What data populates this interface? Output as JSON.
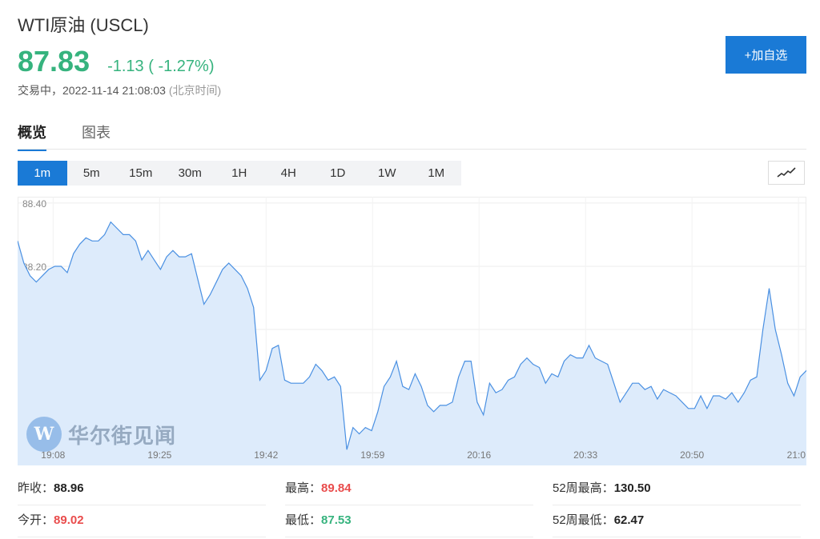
{
  "header": {
    "title": "WTI原油 (USCL)",
    "price": "87.83",
    "change": "-1.13 ( -1.27%)",
    "status": "交易中，2022-11-14 21:08:03",
    "timezone": "(北京时间)",
    "add_button": "+加自选"
  },
  "tabs": [
    {
      "label": "概览",
      "active": true
    },
    {
      "label": "图表",
      "active": false
    }
  ],
  "periods": [
    "1m",
    "5m",
    "15m",
    "30m",
    "1H",
    "4H",
    "1D",
    "1W",
    "1M"
  ],
  "active_period": "1m",
  "watermark": {
    "logo": "W",
    "text": "华尔街见闻"
  },
  "colors": {
    "up": "#e94c4c",
    "down": "#36b37e",
    "accent": "#1a7ad6",
    "line": "#4a90e2",
    "fill": "#ddebfb"
  },
  "stats": {
    "prev_close": {
      "label": "昨收：",
      "value": "88.96"
    },
    "high": {
      "label": "最高：",
      "value": "89.84"
    },
    "high_52w": {
      "label": "52周最高：",
      "value": "130.50"
    },
    "open": {
      "label": "今开：",
      "value": "89.02"
    },
    "low": {
      "label": "最低：",
      "value": "87.53"
    },
    "low_52w": {
      "label": "52周最低：",
      "value": "62.47"
    }
  },
  "chart_data": {
    "type": "area",
    "x_ticks": [
      "19:08",
      "19:25",
      "19:42",
      "19:59",
      "20:16",
      "20:33",
      "20:50",
      "21:0"
    ],
    "y_ticks": [
      "88.40",
      "88.20",
      "88.00",
      "87.80",
      "87.60"
    ],
    "ylim": [
      87.57,
      88.42
    ],
    "xlim": [
      0,
      127
    ],
    "grid": true,
    "series": [
      {
        "values": [
          88.28,
          88.21,
          88.17,
          88.15,
          88.17,
          88.19,
          88.2,
          88.2,
          88.18,
          88.24,
          88.27,
          88.29,
          88.28,
          88.28,
          88.3,
          88.34,
          88.32,
          88.3,
          88.3,
          88.28,
          88.22,
          88.25,
          88.22,
          88.19,
          88.23,
          88.25,
          88.23,
          88.23,
          88.24,
          88.16,
          88.08,
          88.11,
          88.15,
          88.19,
          88.21,
          88.19,
          88.17,
          88.13,
          88.07,
          87.84,
          87.87,
          87.94,
          87.95,
          87.84,
          87.83,
          87.83,
          87.83,
          87.85,
          87.89,
          87.87,
          87.84,
          87.85,
          87.82,
          87.62,
          87.69,
          87.67,
          87.69,
          87.68,
          87.74,
          87.82,
          87.85,
          87.9,
          87.82,
          87.81,
          87.86,
          87.82,
          87.76,
          87.74,
          87.76,
          87.76,
          87.77,
          87.85,
          87.9,
          87.9,
          87.77,
          87.73,
          87.83,
          87.8,
          87.81,
          87.84,
          87.85,
          87.89,
          87.91,
          87.89,
          87.88,
          87.83,
          87.86,
          87.85,
          87.9,
          87.92,
          87.91,
          87.91,
          87.95,
          87.91,
          87.9,
          87.89,
          87.83,
          87.77,
          87.8,
          87.83,
          87.83,
          87.81,
          87.82,
          87.78,
          87.81,
          87.8,
          87.79,
          87.77,
          87.75,
          87.75,
          87.79,
          87.75,
          87.79,
          87.79,
          87.78,
          87.8,
          87.77,
          87.8,
          87.84,
          87.85,
          88.0,
          88.13,
          88.0,
          87.92,
          87.83,
          87.79,
          87.85,
          87.87,
          87.83
        ]
      }
    ]
  }
}
